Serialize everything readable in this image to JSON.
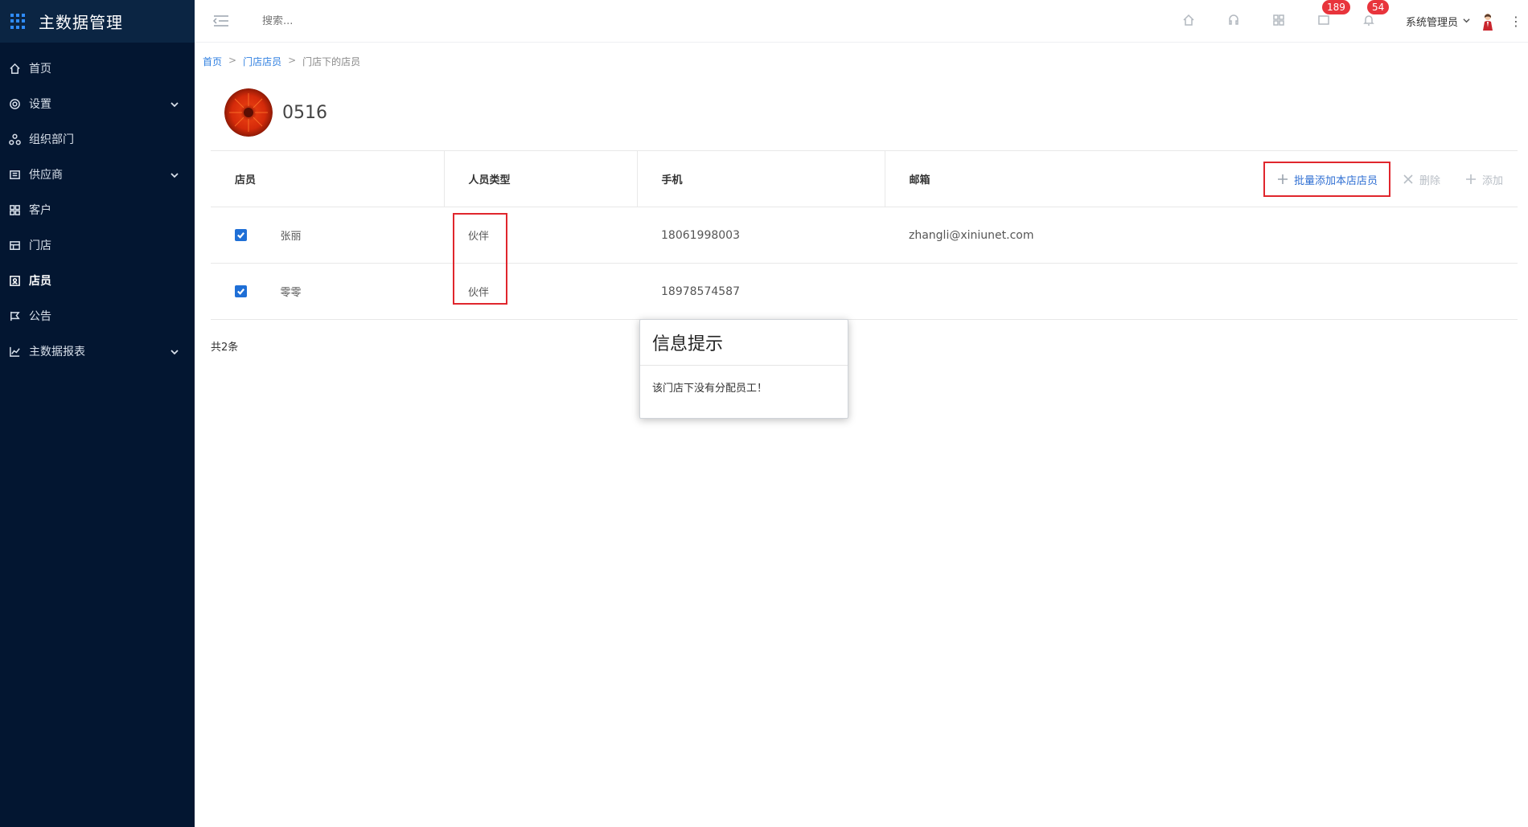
{
  "app": {
    "title": "主数据管理"
  },
  "sidebar": {
    "items": [
      {
        "label": "首页",
        "icon": "home-icon",
        "expandable": false,
        "active": false
      },
      {
        "label": "设置",
        "icon": "gear-icon",
        "expandable": true,
        "active": false
      },
      {
        "label": "组织部门",
        "icon": "org-icon",
        "expandable": false,
        "active": false
      },
      {
        "label": "供应商",
        "icon": "supplier-icon",
        "expandable": true,
        "active": false
      },
      {
        "label": "客户",
        "icon": "customer-icon",
        "expandable": false,
        "active": false
      },
      {
        "label": "门店",
        "icon": "store-icon",
        "expandable": false,
        "active": false
      },
      {
        "label": "店员",
        "icon": "clerk-icon",
        "expandable": false,
        "active": true
      },
      {
        "label": "公告",
        "icon": "announcement-icon",
        "expandable": false,
        "active": false
      },
      {
        "label": "主数据报表",
        "icon": "chart-icon",
        "expandable": true,
        "active": false
      }
    ]
  },
  "topbar": {
    "search_placeholder": "搜索...",
    "badges": {
      "messages": "189",
      "notifications": "54"
    },
    "user_name": "系统管理员"
  },
  "breadcrumb": {
    "home": "首页",
    "parent": "门店店员",
    "current": "门店下的店员"
  },
  "store": {
    "name": "0516"
  },
  "table": {
    "headers": {
      "employee": "店员",
      "type": "人员类型",
      "phone": "手机",
      "email": "邮箱"
    },
    "actions": {
      "batch_add": "批量添加本店店员",
      "delete": "删除",
      "add": "添加"
    },
    "rows": [
      {
        "name": "张丽",
        "type": "伙伴",
        "phone": "18061998003",
        "email": "zhangli@xiniunet.com",
        "checked": true
      },
      {
        "name": "零零",
        "type": "伙伴",
        "phone": "18978574587",
        "email": "",
        "checked": true
      }
    ],
    "total": "共2条"
  },
  "dialog": {
    "title": "信息提示",
    "message": "该门店下没有分配员工！"
  },
  "colors": {
    "sidebar_bg": "#031631",
    "accent": "#2f7fe0",
    "highlight": "#e0262d",
    "badge": "#e8343c"
  }
}
